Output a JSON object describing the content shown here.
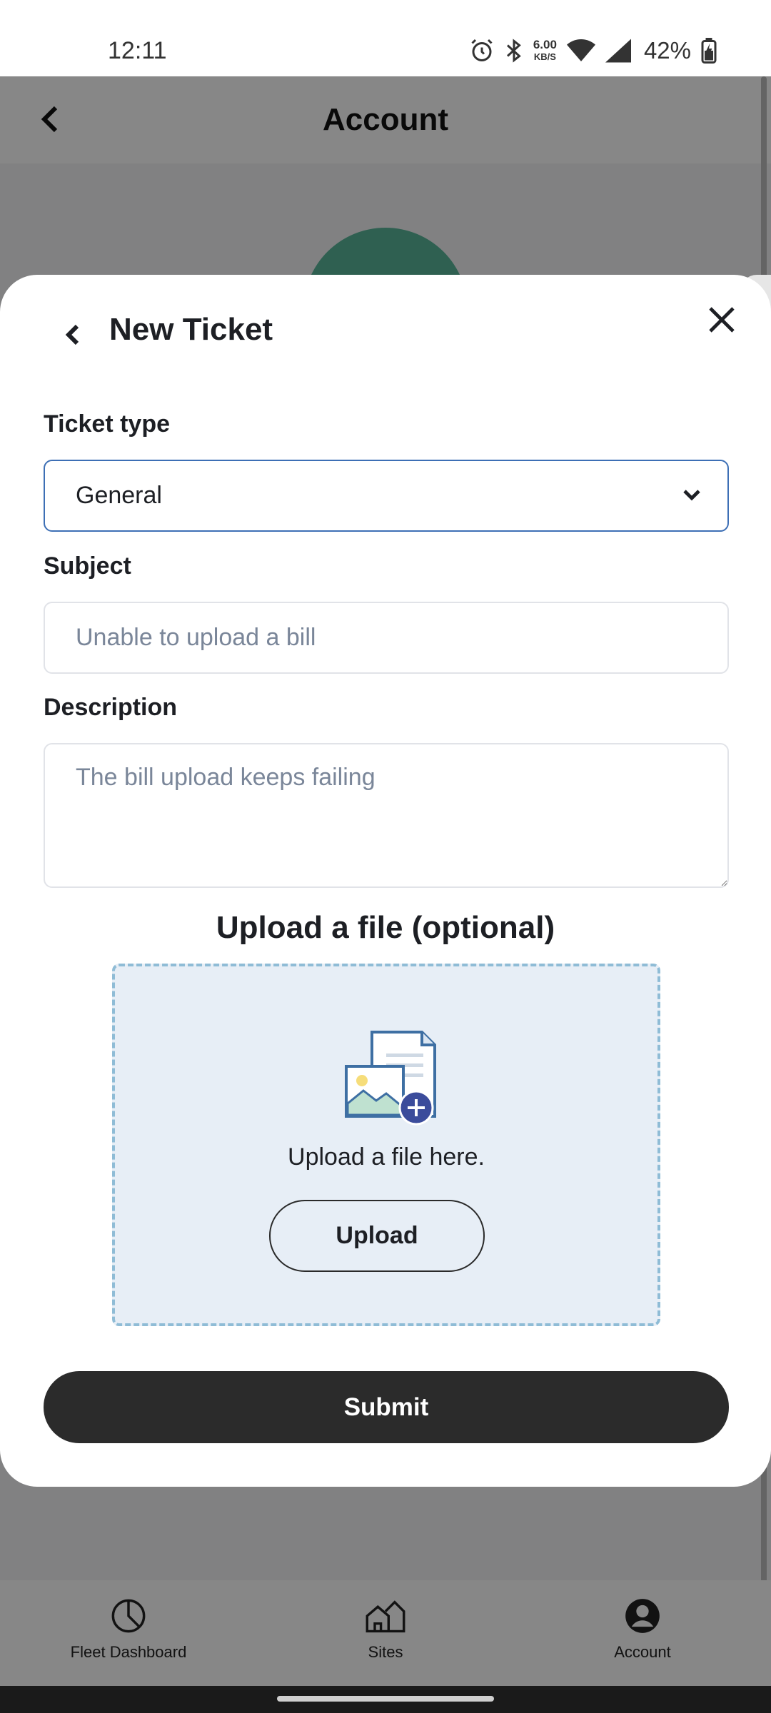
{
  "status_bar": {
    "time": "12:11",
    "net_speed_value": "6.00",
    "net_speed_unit": "KB/S",
    "battery": "42%"
  },
  "background_page": {
    "title": "Account"
  },
  "bottom_nav": {
    "items": [
      {
        "label": "Fleet Dashboard",
        "icon": "pie-chart-icon"
      },
      {
        "label": "Sites",
        "icon": "houses-icon"
      },
      {
        "label": "Account",
        "icon": "user-circle-icon"
      }
    ]
  },
  "sheet": {
    "title": "New Ticket",
    "ticket_type": {
      "label": "Ticket type",
      "selected": "General"
    },
    "subject": {
      "label": "Subject",
      "placeholder": "Unable to upload a bill"
    },
    "description": {
      "label": "Description",
      "placeholder": "The bill upload keeps failing"
    },
    "upload": {
      "heading": "Upload a file (optional)",
      "hint": "Upload a file here.",
      "button_label": "Upload"
    },
    "submit_label": "Submit"
  },
  "colors": {
    "primary_dark": "#2b2b2b",
    "select_border": "#3d6fb5",
    "dropzone_bg": "#e7eef6",
    "dropzone_border": "#8fbcd6",
    "avatar_green": "#5ab59a"
  }
}
